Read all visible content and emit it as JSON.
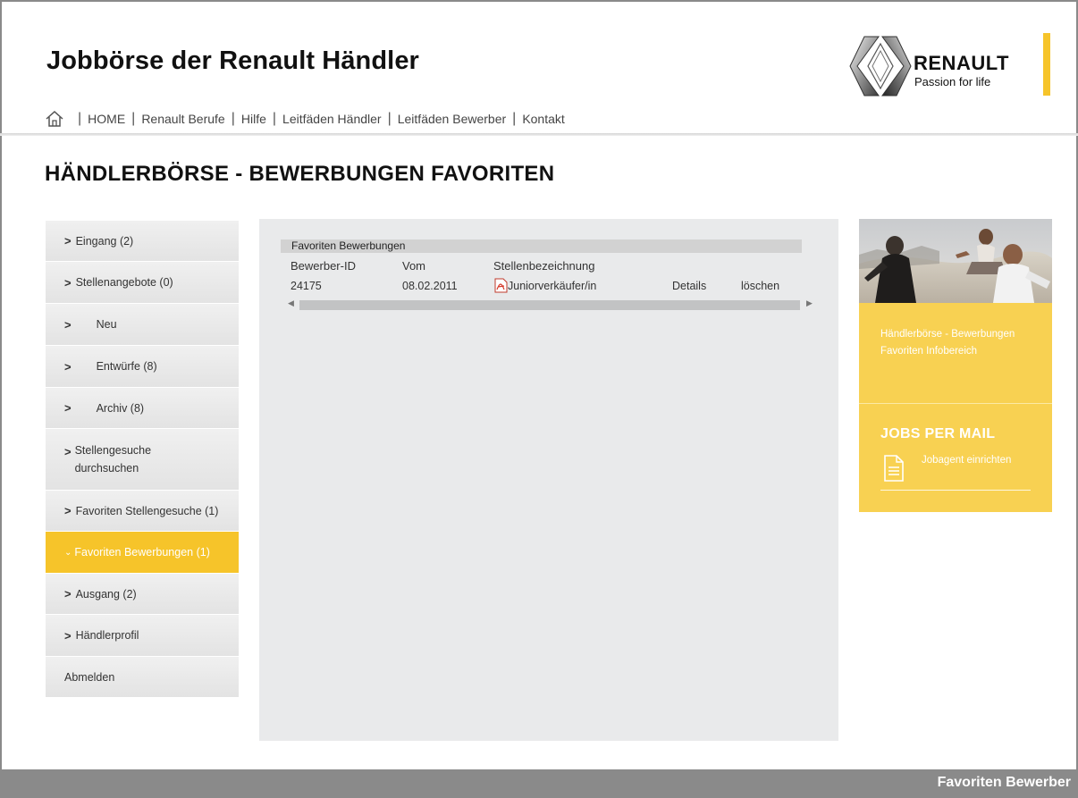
{
  "header": {
    "site_title": "Jobbörse der Renault Händler",
    "logo": {
      "brand": "RENAULT",
      "tagline": "Passion for life",
      "accent": "#f6c42a"
    }
  },
  "nav": {
    "home_icon": "home-icon",
    "items": [
      "HOME",
      "Renault Berufe",
      "Hilfe",
      "Leitfäden Händler",
      "Leitfäden Bewerber",
      "Kontakt"
    ]
  },
  "page_title": "HÄNDLERBÖRSE - BEWERBUNGEN FAVORITEN",
  "sidebar": {
    "items": [
      {
        "label": "Eingang (2)"
      },
      {
        "label": "Stellenangebote (0)"
      },
      {
        "label": "Neu"
      },
      {
        "label": "Entwürfe (8)"
      },
      {
        "label": "Archiv (8)"
      },
      {
        "label": "Stellengesuche durchsuchen"
      },
      {
        "label": "Favoriten Stellengesuche (1)"
      },
      {
        "label": "Favoriten Bewerbungen (1)"
      },
      {
        "label": "Ausgang (2)"
      },
      {
        "label": "Händlerprofil"
      },
      {
        "label": "Abmelden"
      }
    ],
    "active_color": "#f6c42a"
  },
  "main": {
    "section_title": "Favoriten Bewerbungen",
    "columns": [
      "Bewerber-ID",
      "Vom",
      "Stellenbezeichnung"
    ],
    "rows": [
      {
        "id": "24175",
        "date": "08.02.2011",
        "position": "Juniorverkäufer/in",
        "details": "Details",
        "delete": "löschen"
      }
    ]
  },
  "right": {
    "info_text": "Händlerbörse - Bewerbungen Favoriten Infobereich",
    "jobs_title": "JOBS PER MAIL",
    "jobs_link": "Jobagent einrichten",
    "panel_color": "#f8d152"
  },
  "footer": {
    "label": "Favoriten Bewerber",
    "color": "#8a8a8a"
  }
}
